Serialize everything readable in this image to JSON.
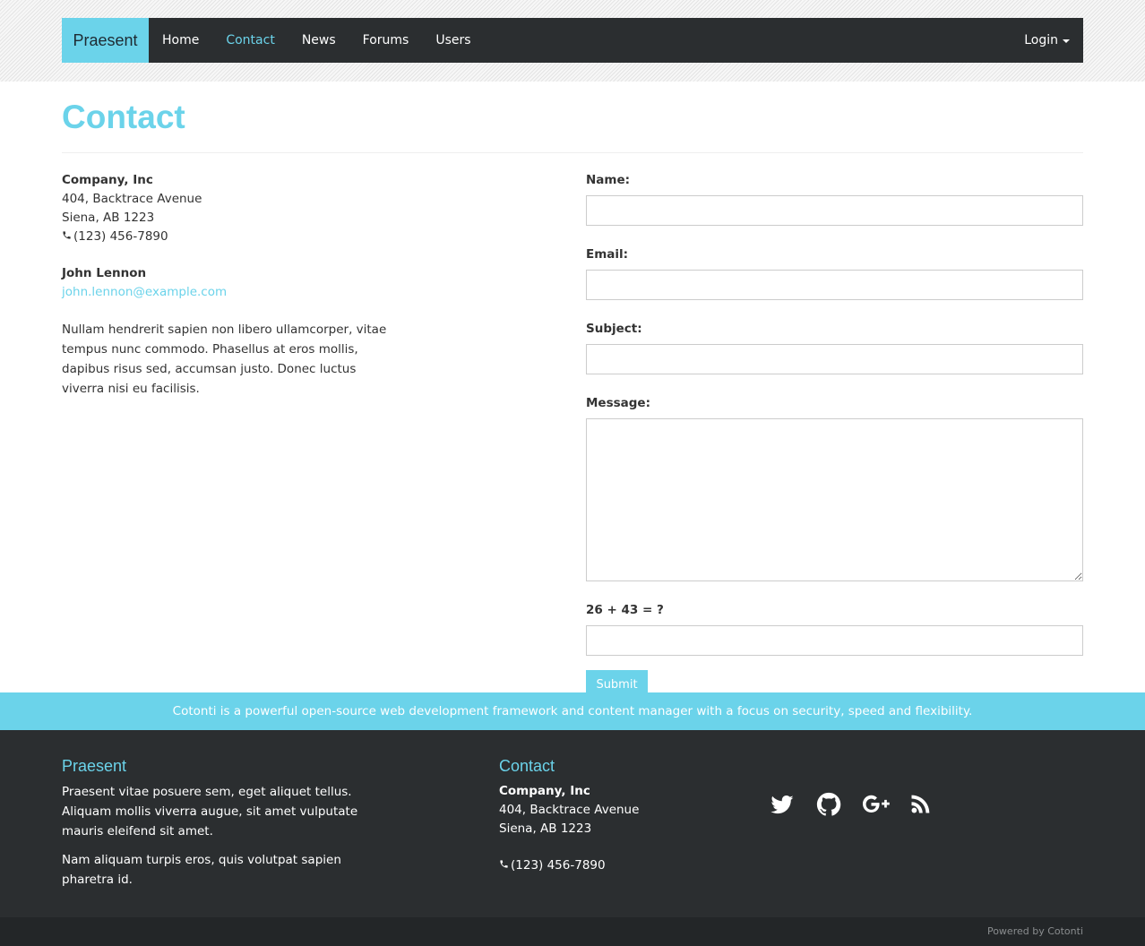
{
  "brand": "Praesent",
  "nav": {
    "items": [
      {
        "label": "Home",
        "active": false
      },
      {
        "label": "Contact",
        "active": true
      },
      {
        "label": "News",
        "active": false
      },
      {
        "label": "Forums",
        "active": false
      },
      {
        "label": "Users",
        "active": false
      }
    ],
    "login_label": "Login"
  },
  "page_title": "Contact",
  "contact_info": {
    "company": "Company, Inc",
    "address_line1": "404, Backtrace Avenue",
    "address_line2": "Siena, AB 1223",
    "phone": "(123) 456-7890",
    "person_name": "John Lennon",
    "person_email": "john.lennon@example.com",
    "description": "Nullam hendrerit sapien non libero ullamcorper, vitae tempus nunc commodo. Phasellus at eros mollis, dapibus risus sed, accumsan justo. Donec luctus viverra nisi eu facilisis."
  },
  "form": {
    "name_label": "Name:",
    "name_value": "",
    "email_label": "Email:",
    "email_value": "",
    "subject_label": "Subject:",
    "subject_value": "",
    "message_label": "Message:",
    "message_value": "",
    "captcha_label": "26 + 43 = ?",
    "captcha_value": "",
    "submit_label": "Submit"
  },
  "info_band_text": "Cotonti is a powerful open-source web development framework and content manager with a focus on security, speed and flexibility.",
  "footer": {
    "col1_title": "Praesent",
    "col1_p1": "Praesent vitae posuere sem, eget aliquet tellus. Aliquam mollis viverra augue, sit amet vulputate mauris eleifend sit amet.",
    "col1_p2": "Nam aliquam turpis eros, quis volutpat sapien pharetra id.",
    "col2_title": "Contact",
    "company": "Company, Inc",
    "address_line1": "404, Backtrace Avenue",
    "address_line2": "Siena, AB 1223",
    "phone": "(123) 456-7890",
    "social_icons": [
      "twitter-icon",
      "github-icon",
      "google-plus-icon",
      "rss-icon"
    ]
  },
  "powered_by": "Powered by Cotonti",
  "colors": {
    "accent": "#6bd3ea",
    "dark": "#2b2e30",
    "darker": "#232628"
  }
}
